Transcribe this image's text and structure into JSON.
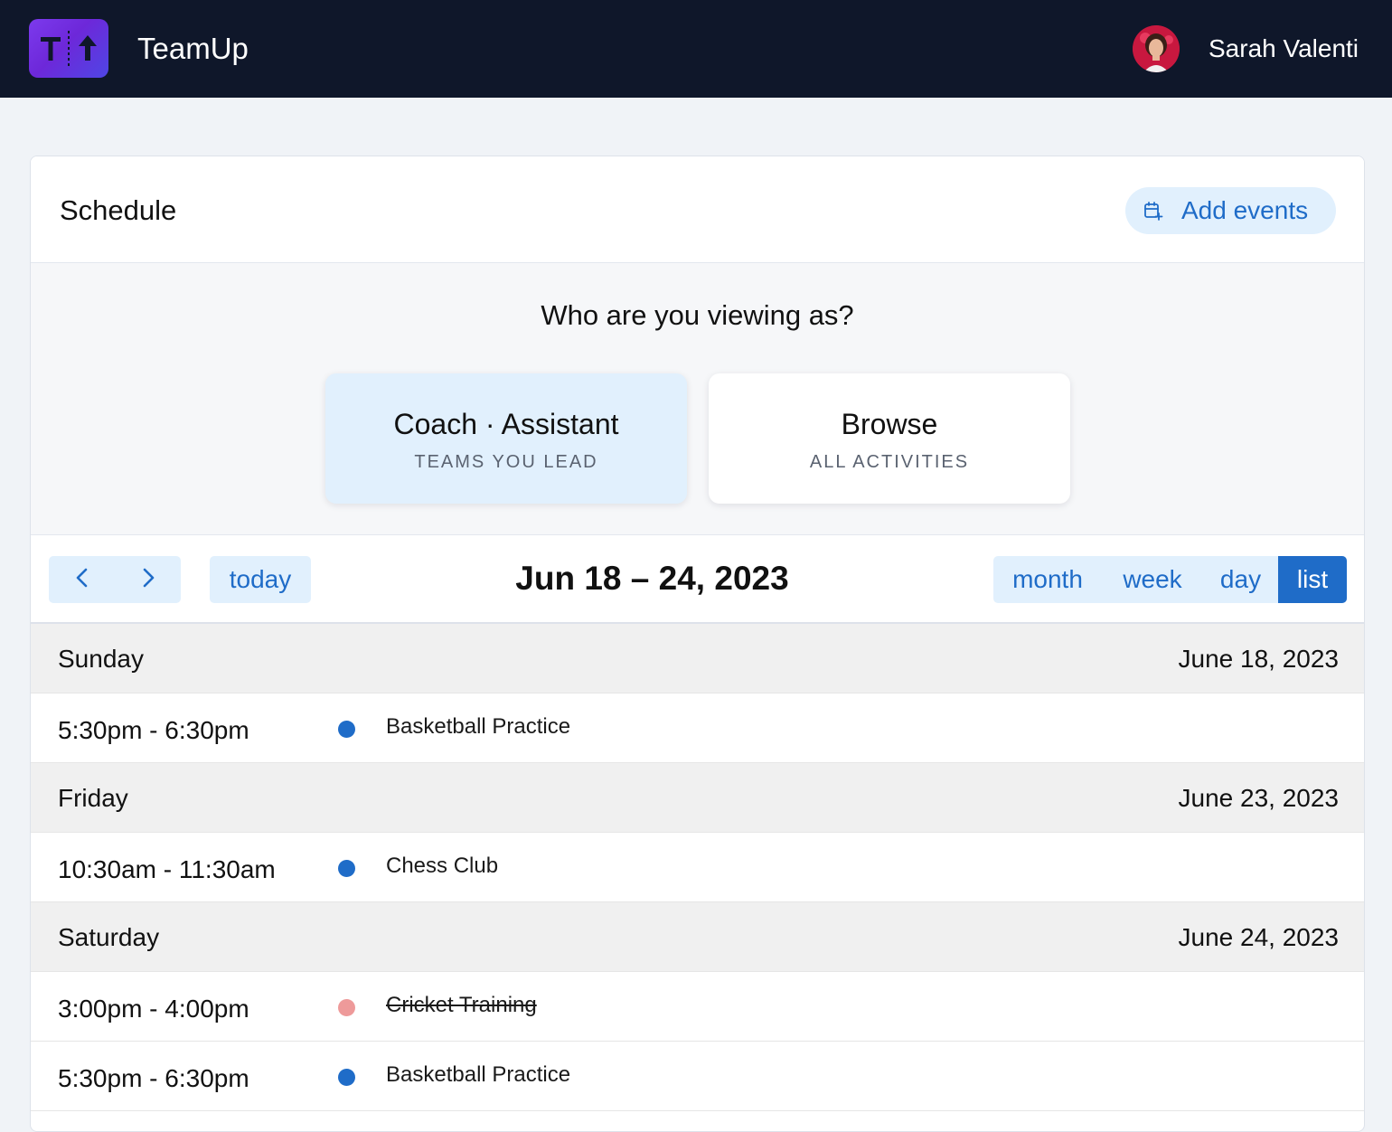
{
  "app": {
    "name": "TeamUp",
    "logo_icon": "teamup-logo-icon",
    "logo_colors": [
      "#7c3aed",
      "#4f46e5"
    ]
  },
  "user": {
    "name": "Sarah Valenti",
    "avatar_icon": "user-avatar"
  },
  "schedule": {
    "title": "Schedule",
    "add_events_label": "Add events",
    "add_events_icon": "calendar-plus-icon"
  },
  "viewing_as": {
    "question": "Who are you viewing as?",
    "options": [
      {
        "title": "Coach · Assistant",
        "subtitle": "TEAMS YOU LEAD",
        "selected": true
      },
      {
        "title": "Browse",
        "subtitle": "ALL ACTIVITIES",
        "selected": false
      }
    ]
  },
  "toolbar": {
    "prev_icon": "chevron-left-icon",
    "next_icon": "chevron-right-icon",
    "today_label": "today",
    "range_title": "Jun 18 – 24, 2023",
    "views": [
      "month",
      "week",
      "day",
      "list"
    ],
    "active_view": "list"
  },
  "colors": {
    "accent": "#1f6cc8",
    "accent_light": "#e1f0fd",
    "topbar": "#0f172a",
    "event_active": "#1f6cc8",
    "event_cancelled": "#ee9a9a"
  },
  "days": [
    {
      "name": "Sunday",
      "date": "June 18, 2023",
      "events": [
        {
          "time": "5:30pm - 6:30pm",
          "title": "Basketball Practice",
          "color": "#1f6cc8",
          "cancelled": false
        }
      ]
    },
    {
      "name": "Friday",
      "date": "June 23, 2023",
      "events": [
        {
          "time": "10:30am - 11:30am",
          "title": "Chess Club",
          "color": "#1f6cc8",
          "cancelled": false
        }
      ]
    },
    {
      "name": "Saturday",
      "date": "June 24, 2023",
      "events": [
        {
          "time": "3:00pm - 4:00pm",
          "title": "Cricket Training",
          "color": "#ee9a9a",
          "cancelled": true
        },
        {
          "time": "5:30pm - 6:30pm",
          "title": "Basketball Practice",
          "color": "#1f6cc8",
          "cancelled": false
        }
      ]
    }
  ]
}
